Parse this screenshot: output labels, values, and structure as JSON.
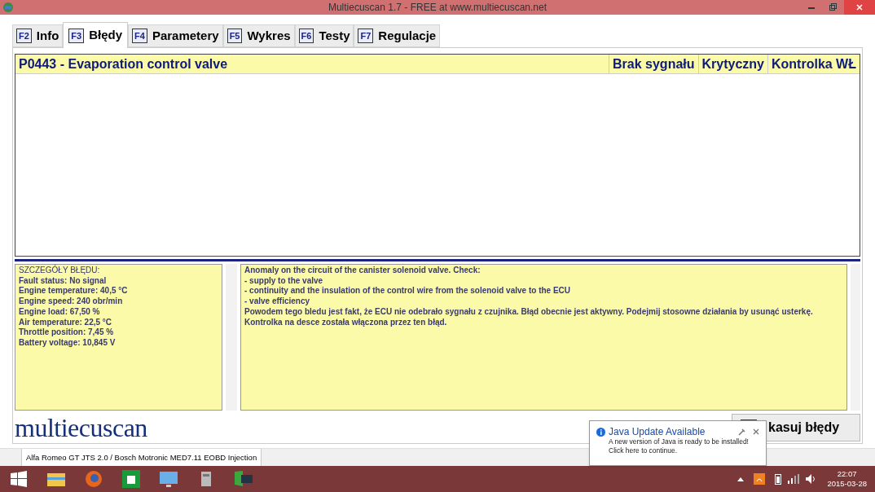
{
  "window": {
    "title": "Multiecuscan 1.7 - FREE at www.multiecuscan.net"
  },
  "tabs": [
    {
      "key": "F2",
      "label": "Info",
      "selected": false
    },
    {
      "key": "F3",
      "label": "Błędy",
      "selected": true
    },
    {
      "key": "F4",
      "label": "Parametery",
      "selected": false
    },
    {
      "key": "F5",
      "label": "Wykres",
      "selected": false
    },
    {
      "key": "F6",
      "label": "Testy",
      "selected": false
    },
    {
      "key": "F7",
      "label": "Regulacje",
      "selected": false
    }
  ],
  "faults": [
    {
      "title": "P0443 - Evaporation control valve",
      "flags": [
        "Brak sygnału",
        "Krytyczny",
        "Kontrolka WŁ"
      ]
    }
  ],
  "details": [
    "SZCZEGÓŁY BŁĘDU:",
    "Fault status: No signal",
    "Engine temperature: 40,5 °C",
    "Engine speed: 240 obr/min",
    "Engine load: 67,50 %",
    "Air temperature: 22,5 °C",
    "Throttle position: 7,45 %",
    "Battery voltage: 10,845 V"
  ],
  "description": [
    "Anomaly on the circuit of the canister solenoid valve. Check:",
    "- supply to the valve",
    "- continuity and the insulation of the control wire from the solenoid valve to the ECU",
    "- valve efficiency",
    "Powodem tego bledu jest fakt, że ECU nie odebrało sygnału z czujnika. Błąd obecnie jest aktywny. Podejmij stosowne działania by usunąć usterkę.",
    "Kontrolka na desce została włączona przez ten błąd."
  ],
  "logo": "multiecuscan",
  "clear_button": "kasuj błędy",
  "status_bar": "Alfa Romeo GT JTS 2.0 / Bosch Motronic MED7.11 EOBD Injection",
  "notification": {
    "title": "Java Update Available",
    "lines": [
      "A new version of Java is ready to be installed!",
      "Click here to continue."
    ]
  },
  "taskbar": {
    "time": "22:07",
    "date": "2015-03-28"
  }
}
